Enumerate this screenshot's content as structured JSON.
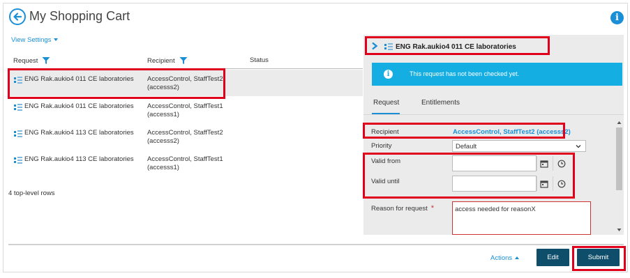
{
  "header": {
    "title": "My Shopping Cart",
    "back_icon": "back-arrow-icon",
    "info_icon": "info-icon",
    "info_glyph": "i"
  },
  "view_settings": {
    "label": "View Settings"
  },
  "table": {
    "columns": [
      {
        "label": "Request",
        "filter": true
      },
      {
        "label": "Recipient",
        "filter": true
      },
      {
        "label": "Status",
        "filter": false
      }
    ],
    "rows": [
      {
        "request": "ENG Rak.aukio4 011 CE laboratories",
        "recipient_line1": "AccessControl, StaffTest2",
        "recipient_line2": "(accesss2)",
        "status": "",
        "selected": true
      },
      {
        "request": "ENG Rak.aukio4 011 CE laboratories",
        "recipient_line1": "AccessControl, StaffTest1",
        "recipient_line2": "(accesss1)",
        "status": "",
        "selected": false
      },
      {
        "request": "ENG Rak.aukio4 113 CE laboratories",
        "recipient_line1": "AccessControl, StaffTest2",
        "recipient_line2": "(accesss2)",
        "status": "",
        "selected": false
      },
      {
        "request": "ENG Rak.aukio4 113 CE laboratories",
        "recipient_line1": "AccessControl, StaffTest1",
        "recipient_line2": "(accesss1)",
        "status": "",
        "selected": false
      }
    ],
    "row_count_label": "4 top-level rows"
  },
  "detail": {
    "title": "ENG Rak.aukio4 011 CE laboratories",
    "alert": {
      "glyph": "i",
      "text": "This request has not been checked yet."
    },
    "tabs": [
      {
        "label": "Request",
        "active": true
      },
      {
        "label": "Entitlements",
        "active": false
      }
    ],
    "form": {
      "recipient_label": "Recipient",
      "recipient_value": "AccessControl, StaffTest2 (accesss2)",
      "priority_label": "Priority",
      "priority_value": "Default",
      "valid_from_label": "Valid from",
      "valid_from_value": "",
      "valid_until_label": "Valid until",
      "valid_until_value": "",
      "reason_label": "Reason for request",
      "reason_required_mark": "*",
      "reason_value": "access needed for reasonX"
    }
  },
  "footer": {
    "actions_label": "Actions",
    "edit_label": "Edit",
    "submit_label": "Submit"
  },
  "colors": {
    "accent": "#1a8fd6",
    "alert_bg": "#14aee2",
    "button_bg": "#0f4e6b",
    "highlight": "#e0001b",
    "selected_row": "#ebebeb"
  }
}
